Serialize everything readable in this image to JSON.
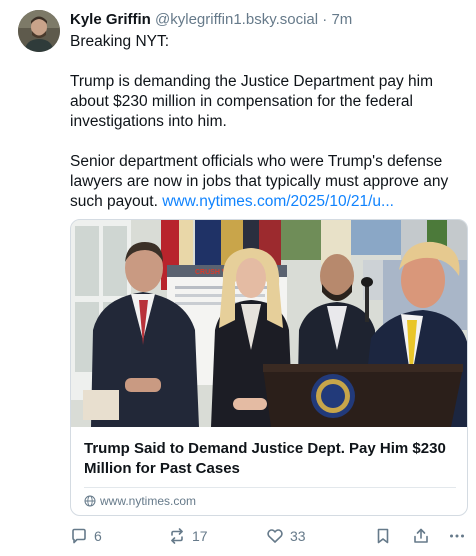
{
  "post": {
    "author_name": "Kyle Griffin",
    "author_handle": "@kylegriffin1.bsky.social",
    "separator": "·",
    "timestamp": "7m",
    "lines": [
      "Breaking NYT:",
      "Trump is demanding the Justice Department pay him about $230 million in compensation for the federal investigations into him.",
      "Senior department officials who were Trump's defense lawyers are now in jobs that typically must approve any such payout."
    ],
    "link_text": "www.nytimes.com/2025/10/21/u..."
  },
  "card": {
    "title": "Trump Said to Demand Justice Dept. Pay Him $230 Million for Past Cases",
    "domain": "www.nytimes.com",
    "image_sign_text": "CRUSH VIOL",
    "image_icon": "photo-press-conference"
  },
  "actions": {
    "reply_count": "6",
    "repost_count": "17",
    "like_count": "33"
  },
  "icons": {
    "reply": "speech-bubble-icon",
    "repost": "repost-arrows-icon",
    "like": "heart-icon",
    "bookmark": "bookmark-icon",
    "share": "share-icon",
    "more": "more-dots-icon",
    "globe": "globe-icon"
  },
  "colors": {
    "text": "#0f1419",
    "muted": "#667a8a",
    "link": "#1083fe",
    "border": "#d4dbe2"
  }
}
